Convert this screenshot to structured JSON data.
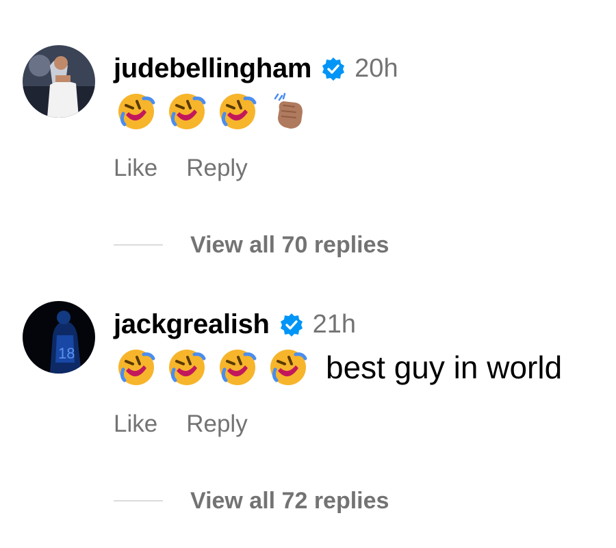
{
  "comments": [
    {
      "username": "judebellingham",
      "verified": true,
      "time": "20h",
      "emojis": [
        "rofl-emoji",
        "rofl-emoji",
        "rofl-emoji",
        "clapping-hands-emoji"
      ],
      "text": "",
      "actions": {
        "like": "Like",
        "reply": "Reply"
      },
      "view_replies": "View all 70 replies"
    },
    {
      "username": "jackgrealish",
      "verified": true,
      "time": "21h",
      "emojis": [
        "rofl-emoji",
        "rofl-emoji",
        "rofl-emoji",
        "rofl-emoji"
      ],
      "text": "best guy in world",
      "actions": {
        "like": "Like",
        "reply": "Reply"
      },
      "view_replies": "View all 72 replies"
    }
  ],
  "colors": {
    "text": "#000000",
    "secondary": "#737373",
    "verified": "#0095f6",
    "divider": "#dbdbdb"
  }
}
